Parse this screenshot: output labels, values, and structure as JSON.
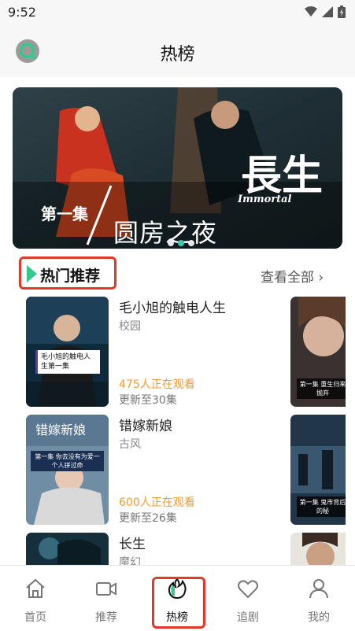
{
  "status_bar": {
    "time": "9:52",
    "icons": [
      "wifi-icon",
      "signal-icon",
      "battery-icon"
    ]
  },
  "header": {
    "title": "热榜",
    "search_icon": "search-icon"
  },
  "banner": {
    "episode_label": "第一集",
    "caption": "圆房之夜",
    "brand_title": "長生",
    "brand_subtitle": "Immortal",
    "pager": {
      "count": 3,
      "active_index": 1
    }
  },
  "section": {
    "title": "热门推荐",
    "view_all": "查看全部 ›"
  },
  "dramas": [
    {
      "title": "毛小旭的触电人生",
      "genre": "校园",
      "watching": "475人正在观看",
      "update": "更新至30集",
      "poster_caption": "毛小旭的触电人生第一集",
      "side_caption": "第一集 重生归来 抛弃"
    },
    {
      "title": "错嫁新娘",
      "genre": "古风",
      "watching": "600人正在观看",
      "update": "更新至26集",
      "poster_title": "错嫁新娘",
      "poster_caption": "第一集 你去没有为爱一个人拼过命",
      "side_caption": "第一集 鬼市背后的秘"
    },
    {
      "title": "长生",
      "genre": "魔幻"
    }
  ],
  "tabbar": {
    "items": [
      {
        "label": "首页",
        "icon": "home-icon"
      },
      {
        "label": "推荐",
        "icon": "video-icon"
      },
      {
        "label": "热榜",
        "icon": "flame-icon"
      },
      {
        "label": "追剧",
        "icon": "heart-icon"
      },
      {
        "label": "我的",
        "icon": "person-icon"
      }
    ],
    "active_index": 2
  },
  "colors": {
    "accent": "#3ccbb0",
    "highlight_border": "#e23a2a",
    "watching": "#f39b2e"
  }
}
